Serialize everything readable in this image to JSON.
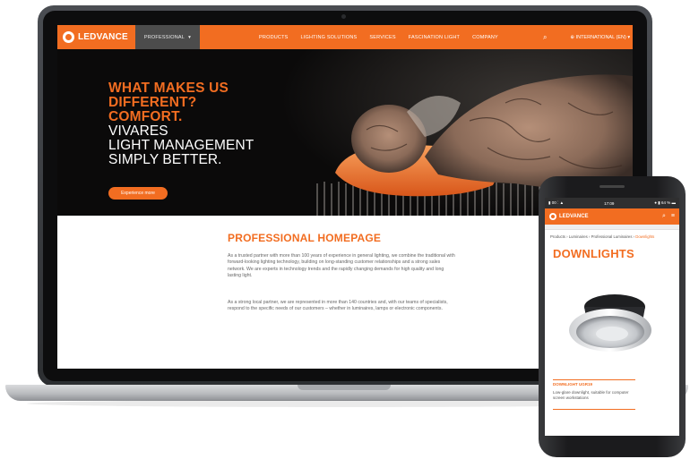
{
  "laptop": {
    "nav": {
      "brand": "LEDVANCE",
      "professional_tab": "PROFESSIONAL",
      "links": [
        "PRODUCTS",
        "LIGHTING SOLUTIONS",
        "SERVICES",
        "FASCINATION LIGHT",
        "COMPANY"
      ],
      "region": "INTERNATIONAL (EN)"
    },
    "hero": {
      "headline_orange": [
        "WHAT MAKES US",
        "DIFFERENT?",
        "COMFORT."
      ],
      "headline_white": [
        "VIVARES",
        "LIGHT MANAGEMENT",
        "SIMPLY BETTER."
      ],
      "cta": "Experience more"
    },
    "content": {
      "title": "PROFESSIONAL HOMEPAGE",
      "paragraph_1": "As a trusted partner with more than 100 years of experience in general lighting, we combine the traditional with forward-looking lighting technology, building on long-standing customer relationships and a strong sales network. We are experts in technology trends and the rapidly changing demands for high quality and long lasting light.",
      "paragraph_2": "As a strong local partner, we are represented in more than 140 countries and, with our teams of specialists, respond to the specific needs of our customers – whether in luminaires, lamps or electronic components."
    }
  },
  "phone": {
    "status": {
      "carrier": "▮ 00 ⁚ ▲",
      "time": "17:09",
      "battery": "● ▮ 64 % ▬"
    },
    "brand": "LEDVANCE",
    "breadcrumb": {
      "trail": "Products › Luminaires › Professional Luminaires › ",
      "current": "Downlights"
    },
    "title": "DOWNLIGHTS",
    "product_label": "DOWNLIGHT UGR19",
    "product_desc": "Low-glare downlight, suitable for computer screen workstations"
  },
  "colors": {
    "brand_orange": "#f26d21",
    "nav_dark": "#4c4c4c",
    "hero_bg": "#0b0a0a"
  }
}
